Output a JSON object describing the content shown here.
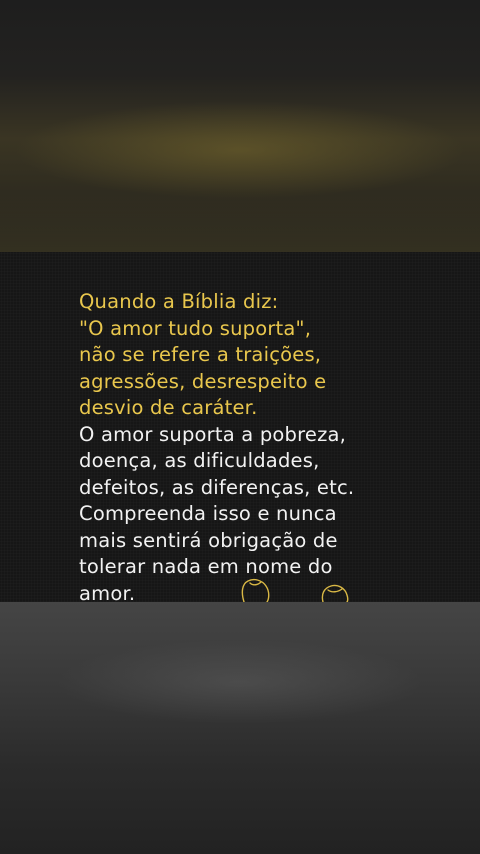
{
  "post": {
    "lines_highlight": [
      "Quando a Bíblia diz:",
      "\"O amor tudo suporta\",",
      "não se refere a traições,",
      "agressões, desrespeito e",
      "desvio de caráter."
    ],
    "lines_body": [
      "O amor suporta a pobreza,",
      "doença, as dificuldades,",
      "defeitos, as diferenças, etc.",
      "Compreenda isso e nunca",
      "mais sentirá obrigação de",
      "tolerar nada em nome do",
      "amor."
    ]
  },
  "colors": {
    "highlight": "#e9c74d",
    "body_text": "#f2f2f2",
    "card_background": "#161616"
  }
}
